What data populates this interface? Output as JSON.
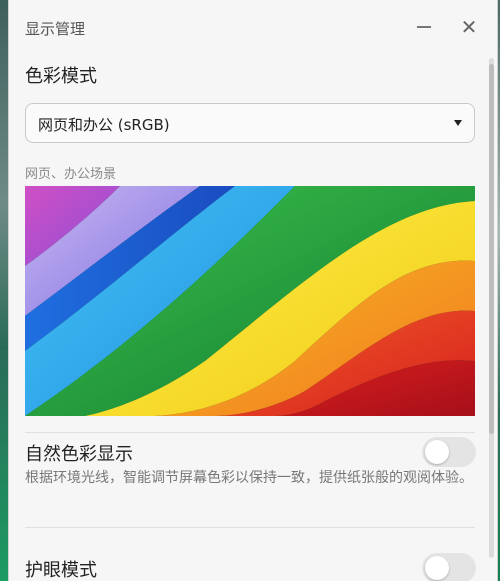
{
  "window": {
    "title": "显示管理",
    "minimize_glyph": "—",
    "close_glyph": "✕"
  },
  "color_mode": {
    "heading": "色彩模式",
    "selected": "网页和办公 (sRGB)",
    "preview_caption": "网页、办公场景",
    "preview_colors": [
      "#c0168f",
      "#8f73d9",
      "#2f73e6",
      "#29b7f0",
      "#2bb24c",
      "#f3de1c",
      "#f39a1f",
      "#e9461f",
      "#c4141f"
    ]
  },
  "natural_color": {
    "title": "自然色彩显示",
    "description": "根据环境光线，智能调节屏幕色彩以保持一致，提供纸张般的观阅体验。",
    "enabled": false
  },
  "eye_care": {
    "title": "护眼模式",
    "enabled": false
  },
  "icons": {
    "dropdown": "caret-down-icon",
    "toggle_off_color": "#e4e4e4"
  }
}
